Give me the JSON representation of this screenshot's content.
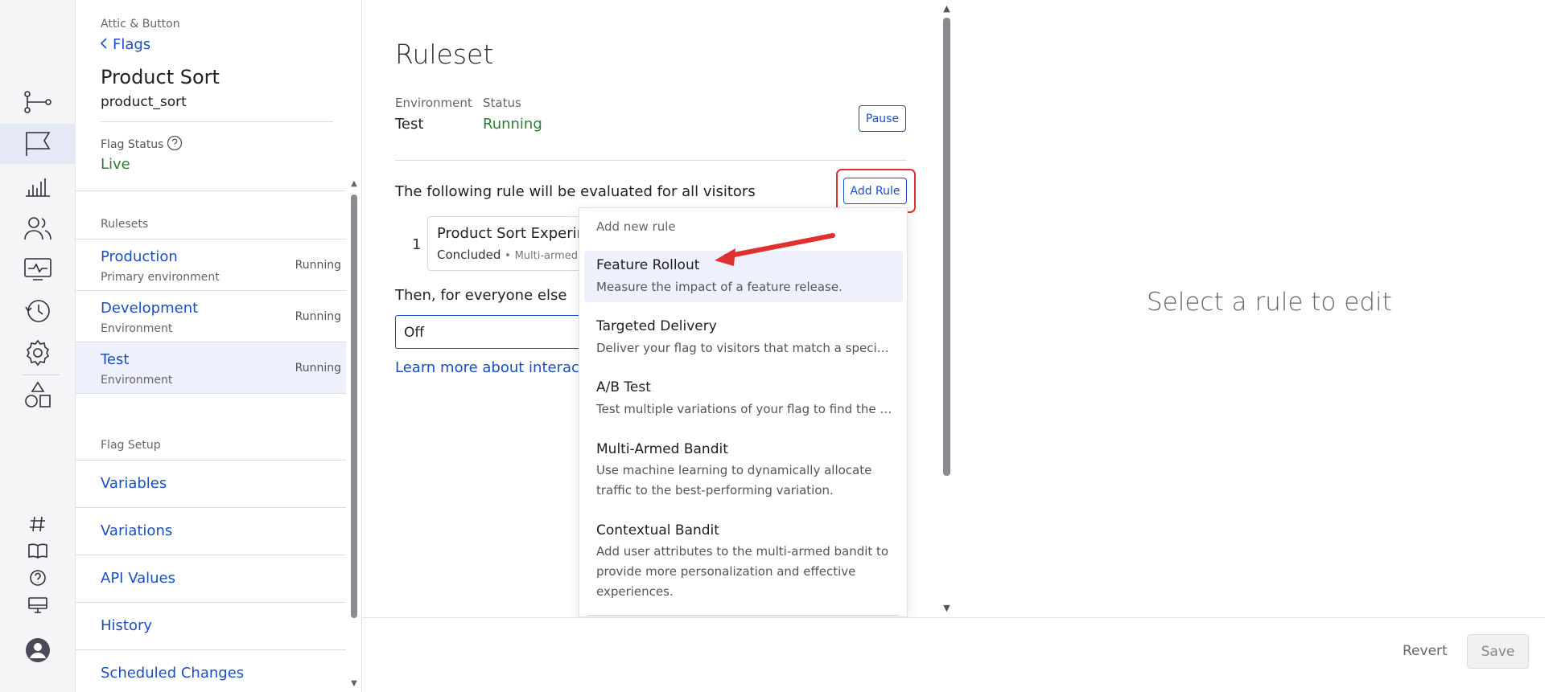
{
  "sidebar": {
    "breadcrumb": "Attic & Button",
    "back_label": "Flags",
    "flag_name": "Product Sort",
    "flag_key": "product_sort",
    "flag_status_label": "Flag Status",
    "flag_status_value": "Live",
    "rulesets_heading": "Rulesets",
    "rulesets": [
      {
        "name": "Production",
        "sub": "Primary environment",
        "status": "Running"
      },
      {
        "name": "Development",
        "sub": "Environment",
        "status": "Running"
      },
      {
        "name": "Test",
        "sub": "Environment",
        "status": "Running"
      }
    ],
    "setup_heading": "Flag Setup",
    "setup_items": [
      {
        "label": "Variables"
      },
      {
        "label": "Variations"
      },
      {
        "label": "API Values"
      },
      {
        "label": "History"
      },
      {
        "label": "Scheduled Changes"
      }
    ]
  },
  "main": {
    "title": "Ruleset",
    "environment_label": "Environment",
    "environment_value": "Test",
    "status_label": "Status",
    "status_value": "Running",
    "pause_label": "Pause",
    "rule_intro": "The following rule will be evaluated for all visitors",
    "add_rule_label": "Add Rule",
    "rule": {
      "number": "1",
      "name": "Product Sort Experiment",
      "state": "Concluded",
      "separator": "•",
      "type": "Multi-armed Bandit"
    },
    "else_text": "Then, for everyone else",
    "else_value": "Off",
    "learn_more": "Learn more about interactions"
  },
  "dropdown": {
    "heading": "Add new rule",
    "items": [
      {
        "title": "Feature Rollout",
        "desc": "Measure the impact of a feature release."
      },
      {
        "title": "Targeted Delivery",
        "desc": "Deliver your flag to visitors that match a specific audience."
      },
      {
        "title": "A/B Test",
        "desc": "Test multiple variations of your flag to find the best performer."
      },
      {
        "title": "Multi-Armed Bandit",
        "desc": "Use machine learning to dynamically allocate traffic to the best-performing variation."
      },
      {
        "title": "Contextual Bandit",
        "desc": "Add user attributes to the multi-armed bandit to provide more personalization and effective experiences."
      }
    ]
  },
  "right_panel": {
    "message": "Select a rule to edit"
  },
  "footer": {
    "revert_label": "Revert",
    "save_label": "Save"
  },
  "colors": {
    "link": "#1a4fc4",
    "success": "#2e7d32",
    "annotation": "#e03131"
  }
}
